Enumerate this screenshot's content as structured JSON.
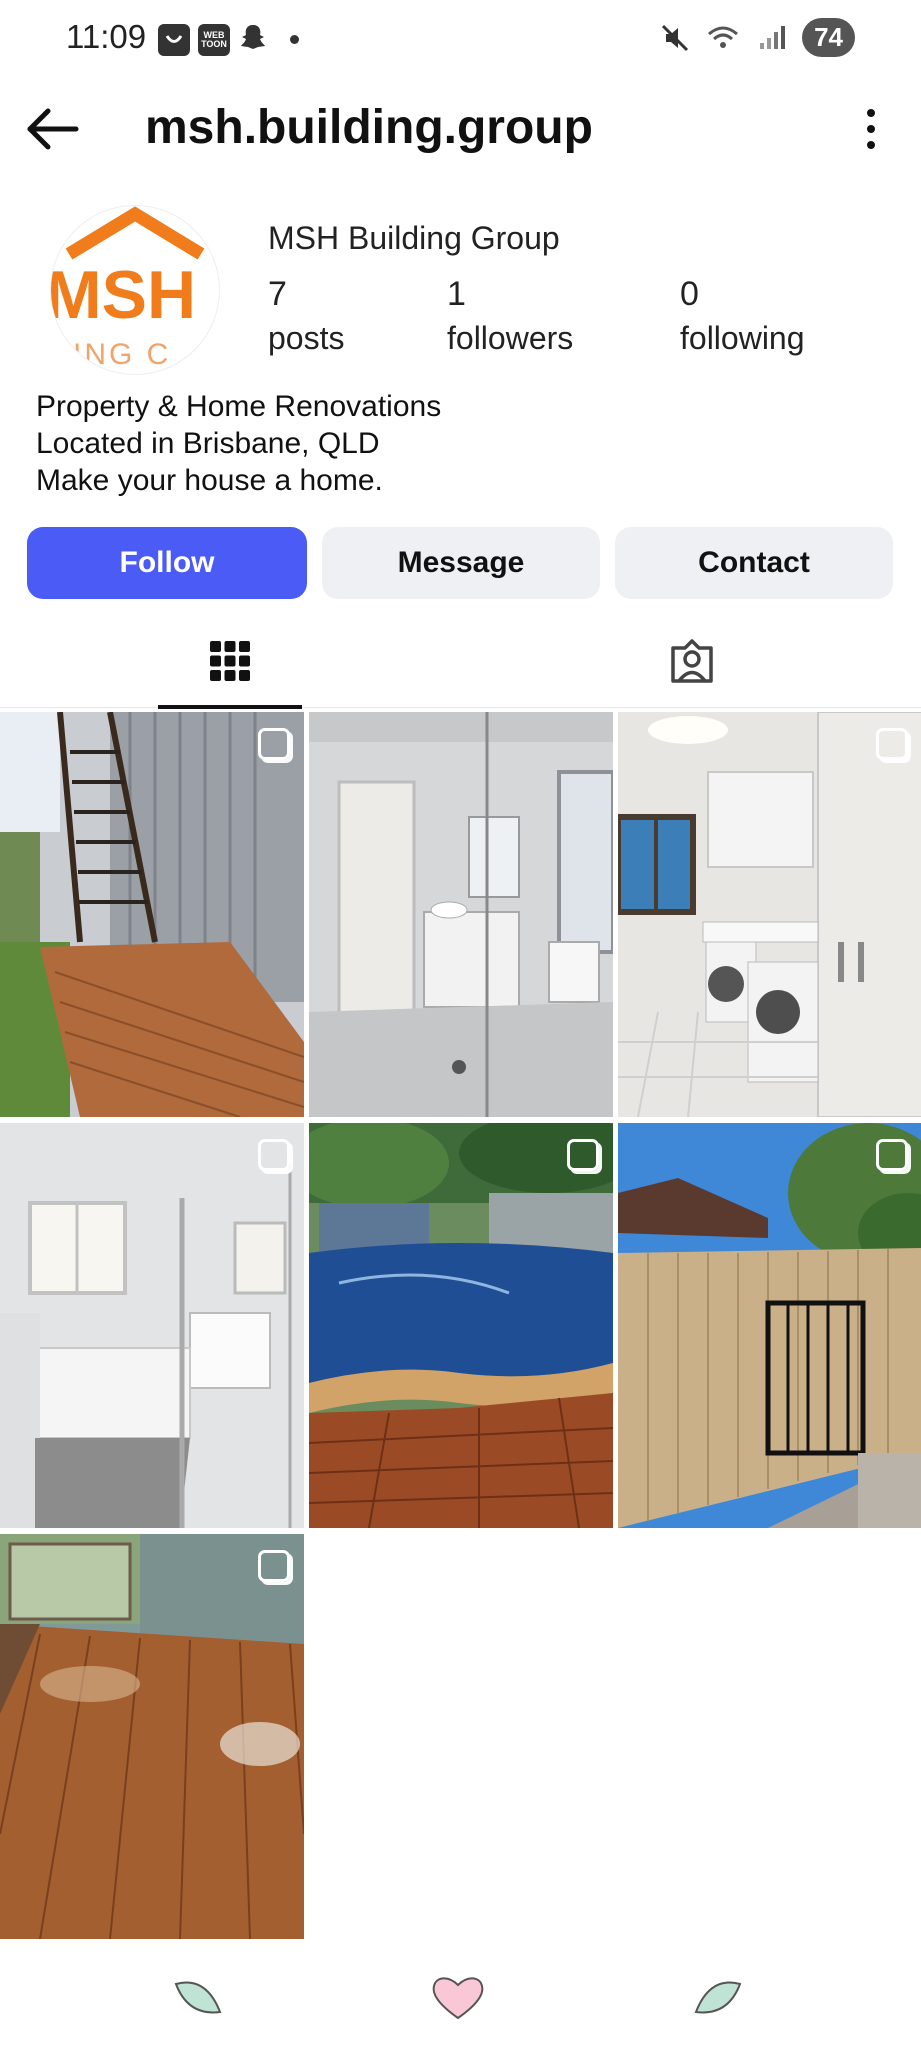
{
  "status_bar": {
    "time": "11:09",
    "battery": "74",
    "webtoon_label": "WEB TOON"
  },
  "header": {
    "username": "msh.building.group"
  },
  "profile": {
    "avatar_text": "MSH",
    "avatar_subtext": "ING C",
    "display_name": "MSH Building Group",
    "stats": [
      {
        "value": "7",
        "label": "posts"
      },
      {
        "value": "1",
        "label": "followers"
      },
      {
        "value": "0",
        "label": "following"
      }
    ],
    "bio_lines": [
      "Property & Home Renovations",
      "Located in Brisbane, QLD",
      "Make your house a home."
    ]
  },
  "actions": {
    "follow": "Follow",
    "message": "Message",
    "contact": "Contact"
  },
  "tabs": [
    {
      "icon": "grid-icon",
      "selected": true
    },
    {
      "icon": "tagged-person-icon",
      "selected": false
    }
  ],
  "posts": [
    {
      "subject": "timber deck and stairs",
      "multi": true
    },
    {
      "subject": "bathroom with shower",
      "multi": false
    },
    {
      "subject": "laundry room",
      "multi": true
    },
    {
      "subject": "bathroom with bathtub",
      "multi": true
    },
    {
      "subject": "pool with timber deck",
      "multi": true
    },
    {
      "subject": "timber fence and gate",
      "multi": true
    },
    {
      "subject": "polished timber floor",
      "multi": true
    }
  ],
  "colors": {
    "accent": "#4a5cf5",
    "secondary_button": "#eff0f4",
    "logo_orange": "#f07c1c"
  }
}
